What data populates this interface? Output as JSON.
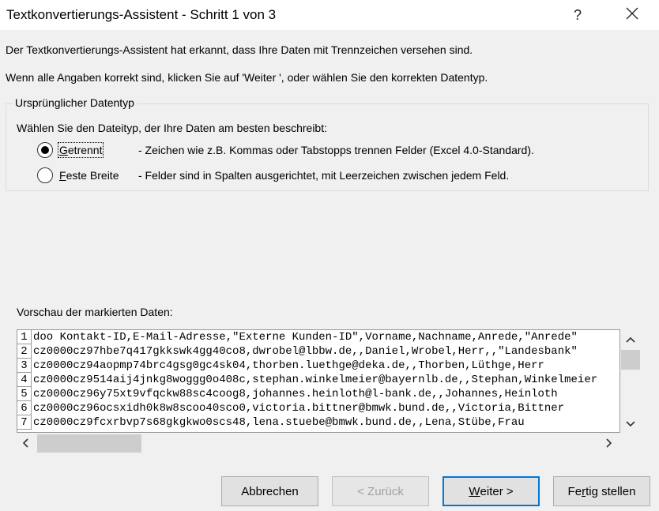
{
  "window": {
    "title": "Textkonvertierungs-Assistent - Schritt 1 von 3",
    "help_label": "?",
    "close_label": "✕"
  },
  "intro": {
    "line1": "Der Textkonvertierungs-Assistent hat erkannt, dass Ihre Daten mit Trennzeichen versehen sind.",
    "line2": "Wenn alle Angaben korrekt sind, klicken Sie auf 'Weiter ', oder wählen Sie den korrekten Datentyp."
  },
  "datatype": {
    "legend": "Ursprünglicher Datentyp",
    "prompt": "Wählen Sie den Dateityp, der Ihre Daten am besten beschreibt:",
    "options": [
      {
        "label_first": "G",
        "label_rest": "etrennt",
        "description": "- Zeichen wie z.B. Kommas oder Tabstopps trennen Felder (Excel 4.0-Standard).",
        "selected": true
      },
      {
        "label_first": "F",
        "label_rest": "este Breite",
        "description": "- Felder sind in Spalten ausgerichtet, mit Leerzeichen zwischen jedem Feld.",
        "selected": false
      }
    ]
  },
  "preview": {
    "label": "Vorschau der markierten Daten:",
    "lines": [
      {
        "num": "1",
        "text": "doo Kontakt-ID,E-Mail-Adresse,\"Externe Kunden-ID\",Vorname,Nachname,Anrede,\"Anrede\""
      },
      {
        "num": "2",
        "text": "cz0000cz97hbe7q417gkkswk4gg40co8,dwrobel@lbbw.de,,Daniel,Wrobel,Herr,,\"Landesbank\""
      },
      {
        "num": "3",
        "text": "cz0000cz94aopmp74brc4gsg0gc4sk04,thorben.luethge@deka.de,,Thorben,Lüthge,Herr"
      },
      {
        "num": "4",
        "text": "cz0000cz9514aij4jnkg8woggg0o408c,stephan.winkelmeier@bayernlb.de,,Stephan,Winkelmeier"
      },
      {
        "num": "5",
        "text": "cz0000cz96y75xt9vfqckw88sc4coog8,johannes.heinloth@l-bank.de,,Johannes,Heinloth"
      },
      {
        "num": "6",
        "text": "cz0000cz96ocsxidh0k8w8scoo40sco0,victoria.bittner@bmwk.bund.de,,Victoria,Bittner"
      },
      {
        "num": "7",
        "text": "cz0000cz9fcxrbvp7s68gkgkwo0scs48,lena.stuebe@bmwk.bund.de,,Lena,Stübe,Frau"
      }
    ]
  },
  "buttons": {
    "cancel": "Abbrechen",
    "back": "< Zurück",
    "next_first": "W",
    "next_rest": "eiter >",
    "finish_pre": "Fe",
    "finish_u": "r",
    "finish_post": "tig stellen"
  }
}
